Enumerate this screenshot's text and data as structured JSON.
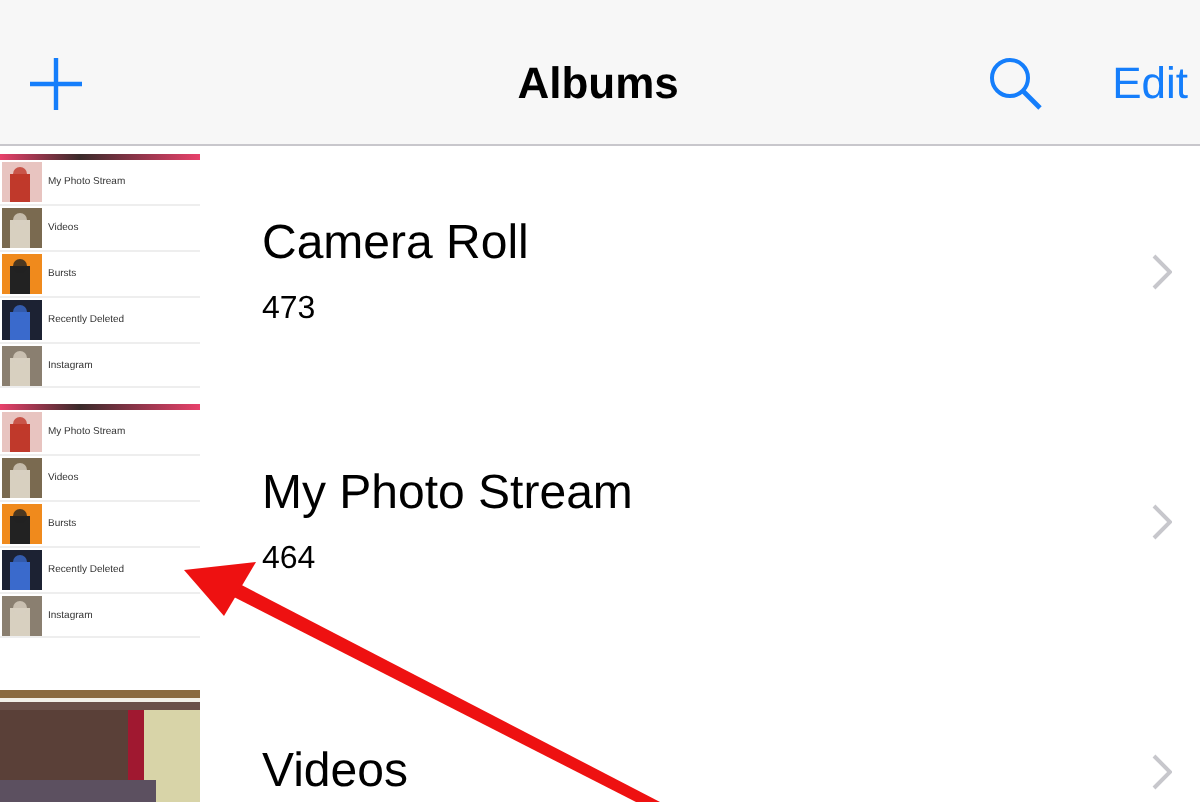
{
  "nav": {
    "title": "Albums",
    "edit": "Edit"
  },
  "albums": [
    {
      "title": "Camera Roll",
      "count": "473",
      "thumb": {
        "kind": "list",
        "rows": [
          "My Photo Stream",
          "Videos",
          "Bursts",
          "Recently Deleted",
          "Instagram"
        ]
      }
    },
    {
      "title": "My Photo Stream",
      "count": "464",
      "thumb": {
        "kind": "list",
        "rows": [
          "My Photo Stream",
          "Videos",
          "Bursts",
          "Recently Deleted",
          "Instagram"
        ]
      }
    },
    {
      "title": "Videos"
    }
  ],
  "annotation": {
    "kind": "arrow"
  }
}
